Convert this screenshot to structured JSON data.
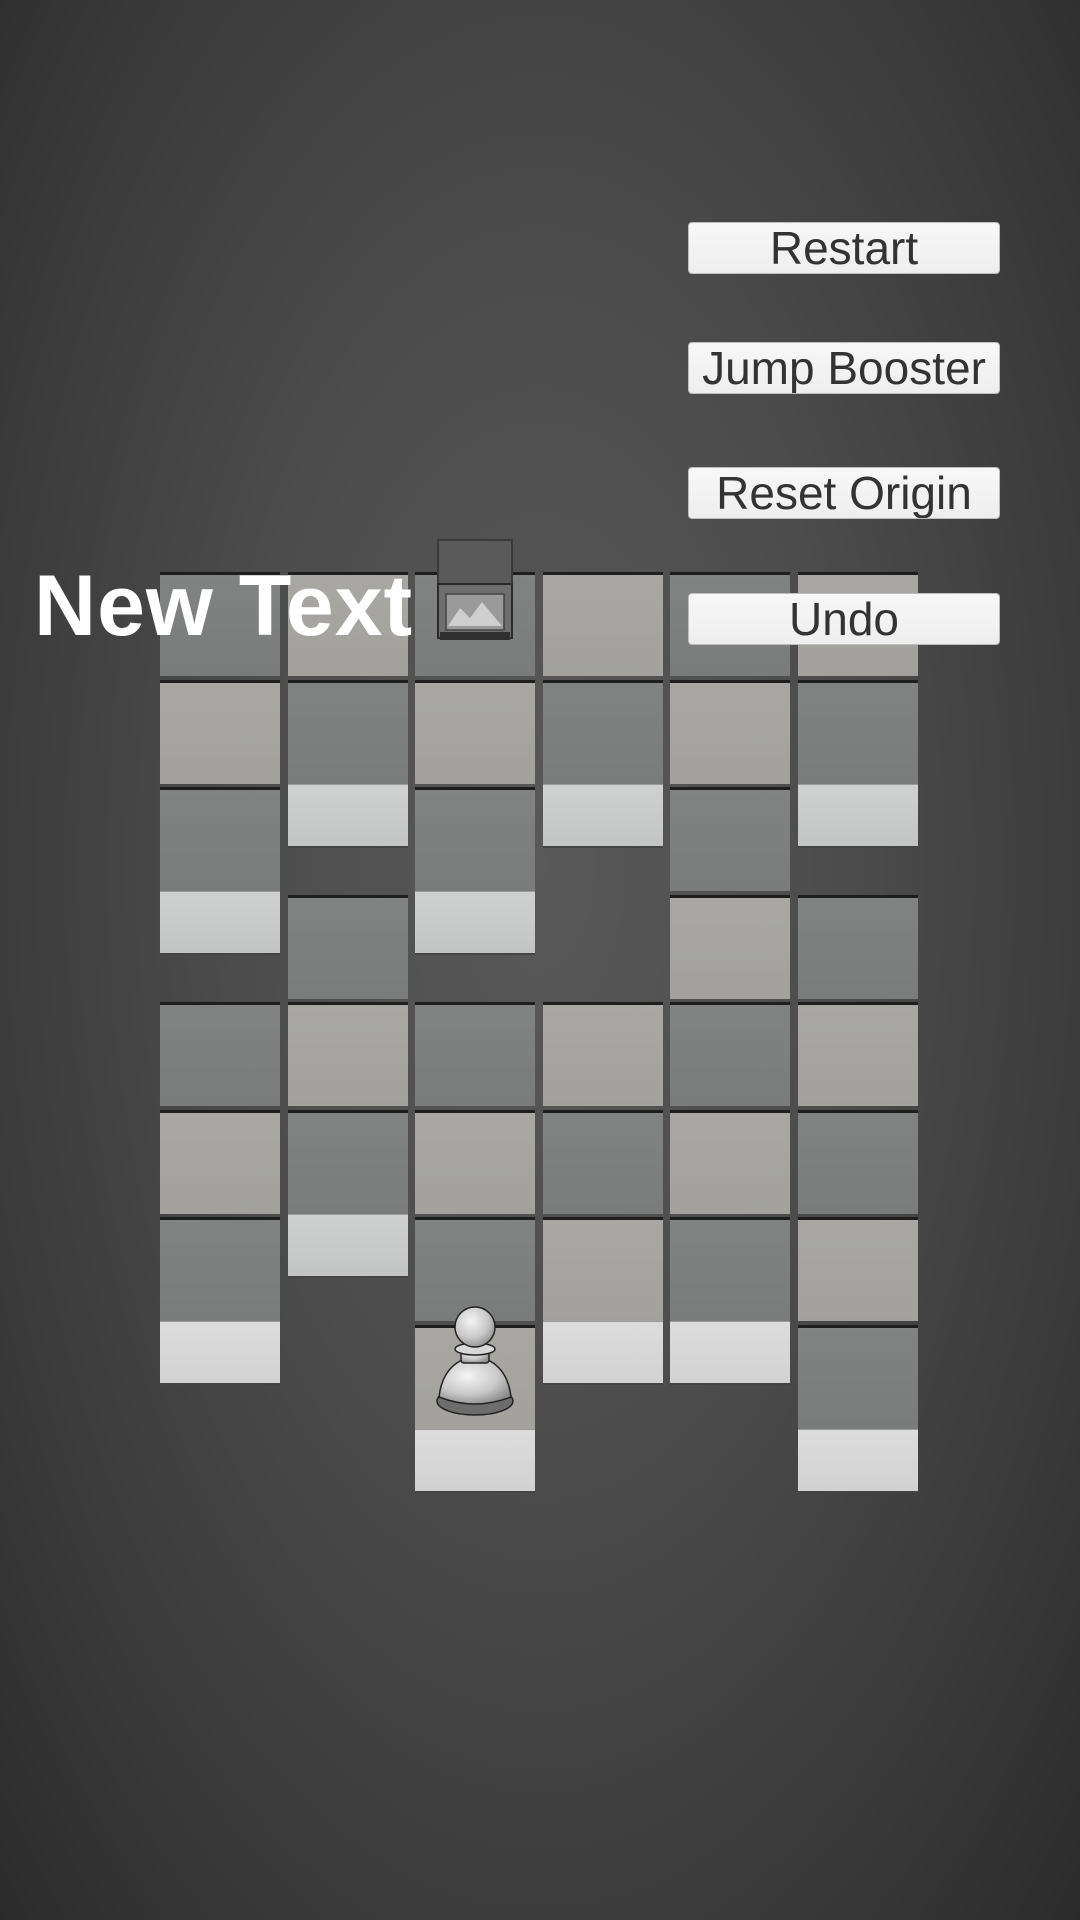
{
  "hud": {
    "label": "New Text",
    "buttons": {
      "restart": "Restart",
      "jump_booster": "Jump Booster",
      "reset_origin": "Reset Origin",
      "undo": "Undo"
    }
  },
  "board": {
    "columns": 6,
    "tiles": [
      {
        "col": 0,
        "row": 0,
        "shade": "dark"
      },
      {
        "col": 1,
        "row": 0,
        "shade": "light"
      },
      {
        "col": 2,
        "row": 0,
        "shade": "dark"
      },
      {
        "col": 3,
        "row": 0,
        "shade": "light"
      },
      {
        "col": 4,
        "row": 0,
        "shade": "dark"
      },
      {
        "col": 5,
        "row": 0,
        "shade": "light"
      },
      {
        "col": 0,
        "row": 1,
        "shade": "light"
      },
      {
        "col": 1,
        "row": 1,
        "shade": "dark"
      },
      {
        "col": 2,
        "row": 1,
        "shade": "light"
      },
      {
        "col": 3,
        "row": 1,
        "shade": "dark"
      },
      {
        "col": 4,
        "row": 1,
        "shade": "light"
      },
      {
        "col": 5,
        "row": 1,
        "shade": "dark"
      },
      {
        "col": 0,
        "row": 2,
        "shade": "dark"
      },
      {
        "col": 2,
        "row": 2,
        "shade": "dark"
      },
      {
        "col": 4,
        "row": 2,
        "shade": "dark"
      },
      {
        "col": 1,
        "row": 3,
        "shade": "dark"
      },
      {
        "col": 4,
        "row": 3,
        "shade": "light"
      },
      {
        "col": 5,
        "row": 3,
        "shade": "dark"
      },
      {
        "col": 0,
        "row": 4,
        "shade": "dark"
      },
      {
        "col": 1,
        "row": 4,
        "shade": "light"
      },
      {
        "col": 2,
        "row": 4,
        "shade": "dark"
      },
      {
        "col": 3,
        "row": 4,
        "shade": "light"
      },
      {
        "col": 4,
        "row": 4,
        "shade": "dark"
      },
      {
        "col": 5,
        "row": 4,
        "shade": "light"
      },
      {
        "col": 0,
        "row": 5,
        "shade": "light"
      },
      {
        "col": 1,
        "row": 5,
        "shade": "dark"
      },
      {
        "col": 2,
        "row": 5,
        "shade": "light"
      },
      {
        "col": 3,
        "row": 5,
        "shade": "dark"
      },
      {
        "col": 4,
        "row": 5,
        "shade": "light"
      },
      {
        "col": 5,
        "row": 5,
        "shade": "dark"
      },
      {
        "col": 0,
        "row": 6,
        "shade": "dark"
      },
      {
        "col": 2,
        "row": 6,
        "shade": "dark"
      },
      {
        "col": 3,
        "row": 6,
        "shade": "light"
      },
      {
        "col": 4,
        "row": 6,
        "shade": "dark"
      },
      {
        "col": 5,
        "row": 6,
        "shade": "light"
      },
      {
        "col": 2,
        "row": 7,
        "shade": "light"
      },
      {
        "col": 5,
        "row": 7,
        "shade": "dark"
      }
    ],
    "pieces": [
      {
        "type": "pawn",
        "col": 2,
        "row": 7
      },
      {
        "type": "box",
        "col": 2,
        "row": 0
      }
    ]
  }
}
